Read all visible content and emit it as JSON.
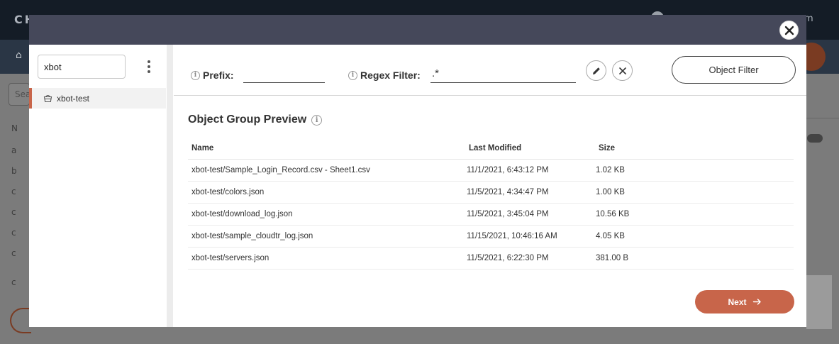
{
  "background": {
    "logo": "CH",
    "user_text": "om",
    "search_placeholder": "Sea",
    "sidebar_items": [
      "N",
      "a",
      "b",
      "c",
      "c",
      "c",
      "c",
      "c"
    ]
  },
  "modal": {
    "sidebar": {
      "search_value": "xbot",
      "buckets": [
        {
          "label": "xbot-test",
          "icon": "bucket-icon",
          "selected": true
        }
      ]
    },
    "filters": {
      "prefix_label": "Prefix:",
      "prefix_value": "",
      "regex_label": "Regex Filter:",
      "regex_value": ".*",
      "object_filter_label": "Object Filter"
    },
    "preview": {
      "title": "Object Group Preview",
      "columns": [
        "Name",
        "Last Modified",
        "Size"
      ],
      "rows": [
        {
          "name": "xbot-test/Sample_Login_Record.csv - Sheet1.csv",
          "modified": "11/1/2021, 6:43:12 PM",
          "size": "1.02 KB"
        },
        {
          "name": "xbot-test/colors.json",
          "modified": "11/5/2021, 4:34:47 PM",
          "size": "1.00 KB"
        },
        {
          "name": "xbot-test/download_log.json",
          "modified": "11/5/2021, 3:45:04 PM",
          "size": "10.56 KB"
        },
        {
          "name": "xbot-test/sample_cloudtr_log.json",
          "modified": "11/15/2021, 10:46:16 AM",
          "size": "4.05 KB"
        },
        {
          "name": "xbot-test/servers.json",
          "modified": "11/5/2021, 6:22:30 PM",
          "size": "381.00 B"
        }
      ]
    },
    "next_label": "Next"
  },
  "colors": {
    "accent": "#c8654a",
    "modal_header": "#45485a"
  }
}
